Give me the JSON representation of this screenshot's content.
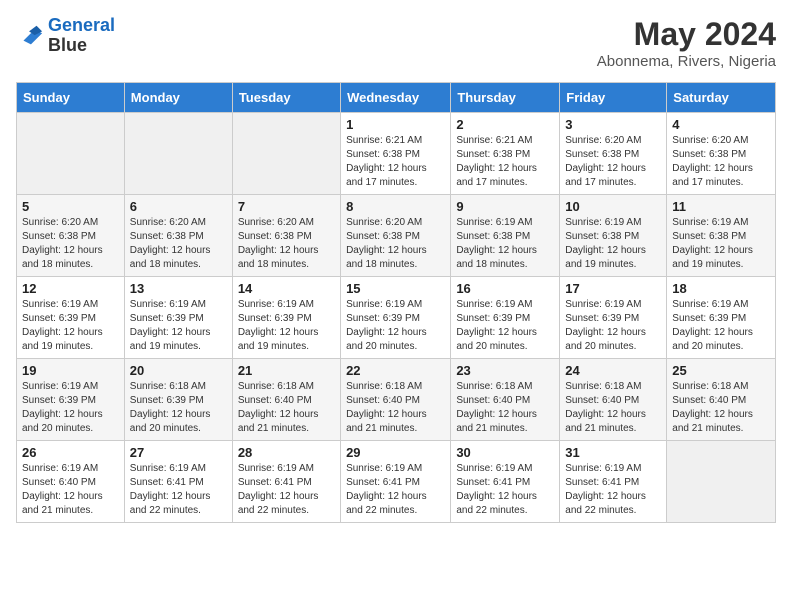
{
  "header": {
    "logo_line1": "General",
    "logo_line2": "Blue",
    "month_year": "May 2024",
    "location": "Abonnema, Rivers, Nigeria"
  },
  "days_of_week": [
    "Sunday",
    "Monday",
    "Tuesday",
    "Wednesday",
    "Thursday",
    "Friday",
    "Saturday"
  ],
  "weeks": [
    [
      {
        "day": "",
        "info": ""
      },
      {
        "day": "",
        "info": ""
      },
      {
        "day": "",
        "info": ""
      },
      {
        "day": "1",
        "info": "Sunrise: 6:21 AM\nSunset: 6:38 PM\nDaylight: 12 hours and 17 minutes."
      },
      {
        "day": "2",
        "info": "Sunrise: 6:21 AM\nSunset: 6:38 PM\nDaylight: 12 hours and 17 minutes."
      },
      {
        "day": "3",
        "info": "Sunrise: 6:20 AM\nSunset: 6:38 PM\nDaylight: 12 hours and 17 minutes."
      },
      {
        "day": "4",
        "info": "Sunrise: 6:20 AM\nSunset: 6:38 PM\nDaylight: 12 hours and 17 minutes."
      }
    ],
    [
      {
        "day": "5",
        "info": "Sunrise: 6:20 AM\nSunset: 6:38 PM\nDaylight: 12 hours and 18 minutes."
      },
      {
        "day": "6",
        "info": "Sunrise: 6:20 AM\nSunset: 6:38 PM\nDaylight: 12 hours and 18 minutes."
      },
      {
        "day": "7",
        "info": "Sunrise: 6:20 AM\nSunset: 6:38 PM\nDaylight: 12 hours and 18 minutes."
      },
      {
        "day": "8",
        "info": "Sunrise: 6:20 AM\nSunset: 6:38 PM\nDaylight: 12 hours and 18 minutes."
      },
      {
        "day": "9",
        "info": "Sunrise: 6:19 AM\nSunset: 6:38 PM\nDaylight: 12 hours and 18 minutes."
      },
      {
        "day": "10",
        "info": "Sunrise: 6:19 AM\nSunset: 6:38 PM\nDaylight: 12 hours and 19 minutes."
      },
      {
        "day": "11",
        "info": "Sunrise: 6:19 AM\nSunset: 6:38 PM\nDaylight: 12 hours and 19 minutes."
      }
    ],
    [
      {
        "day": "12",
        "info": "Sunrise: 6:19 AM\nSunset: 6:39 PM\nDaylight: 12 hours and 19 minutes."
      },
      {
        "day": "13",
        "info": "Sunrise: 6:19 AM\nSunset: 6:39 PM\nDaylight: 12 hours and 19 minutes."
      },
      {
        "day": "14",
        "info": "Sunrise: 6:19 AM\nSunset: 6:39 PM\nDaylight: 12 hours and 19 minutes."
      },
      {
        "day": "15",
        "info": "Sunrise: 6:19 AM\nSunset: 6:39 PM\nDaylight: 12 hours and 20 minutes."
      },
      {
        "day": "16",
        "info": "Sunrise: 6:19 AM\nSunset: 6:39 PM\nDaylight: 12 hours and 20 minutes."
      },
      {
        "day": "17",
        "info": "Sunrise: 6:19 AM\nSunset: 6:39 PM\nDaylight: 12 hours and 20 minutes."
      },
      {
        "day": "18",
        "info": "Sunrise: 6:19 AM\nSunset: 6:39 PM\nDaylight: 12 hours and 20 minutes."
      }
    ],
    [
      {
        "day": "19",
        "info": "Sunrise: 6:19 AM\nSunset: 6:39 PM\nDaylight: 12 hours and 20 minutes."
      },
      {
        "day": "20",
        "info": "Sunrise: 6:18 AM\nSunset: 6:39 PM\nDaylight: 12 hours and 20 minutes."
      },
      {
        "day": "21",
        "info": "Sunrise: 6:18 AM\nSunset: 6:40 PM\nDaylight: 12 hours and 21 minutes."
      },
      {
        "day": "22",
        "info": "Sunrise: 6:18 AM\nSunset: 6:40 PM\nDaylight: 12 hours and 21 minutes."
      },
      {
        "day": "23",
        "info": "Sunrise: 6:18 AM\nSunset: 6:40 PM\nDaylight: 12 hours and 21 minutes."
      },
      {
        "day": "24",
        "info": "Sunrise: 6:18 AM\nSunset: 6:40 PM\nDaylight: 12 hours and 21 minutes."
      },
      {
        "day": "25",
        "info": "Sunrise: 6:18 AM\nSunset: 6:40 PM\nDaylight: 12 hours and 21 minutes."
      }
    ],
    [
      {
        "day": "26",
        "info": "Sunrise: 6:19 AM\nSunset: 6:40 PM\nDaylight: 12 hours and 21 minutes."
      },
      {
        "day": "27",
        "info": "Sunrise: 6:19 AM\nSunset: 6:41 PM\nDaylight: 12 hours and 22 minutes."
      },
      {
        "day": "28",
        "info": "Sunrise: 6:19 AM\nSunset: 6:41 PM\nDaylight: 12 hours and 22 minutes."
      },
      {
        "day": "29",
        "info": "Sunrise: 6:19 AM\nSunset: 6:41 PM\nDaylight: 12 hours and 22 minutes."
      },
      {
        "day": "30",
        "info": "Sunrise: 6:19 AM\nSunset: 6:41 PM\nDaylight: 12 hours and 22 minutes."
      },
      {
        "day": "31",
        "info": "Sunrise: 6:19 AM\nSunset: 6:41 PM\nDaylight: 12 hours and 22 minutes."
      },
      {
        "day": "",
        "info": ""
      }
    ]
  ]
}
